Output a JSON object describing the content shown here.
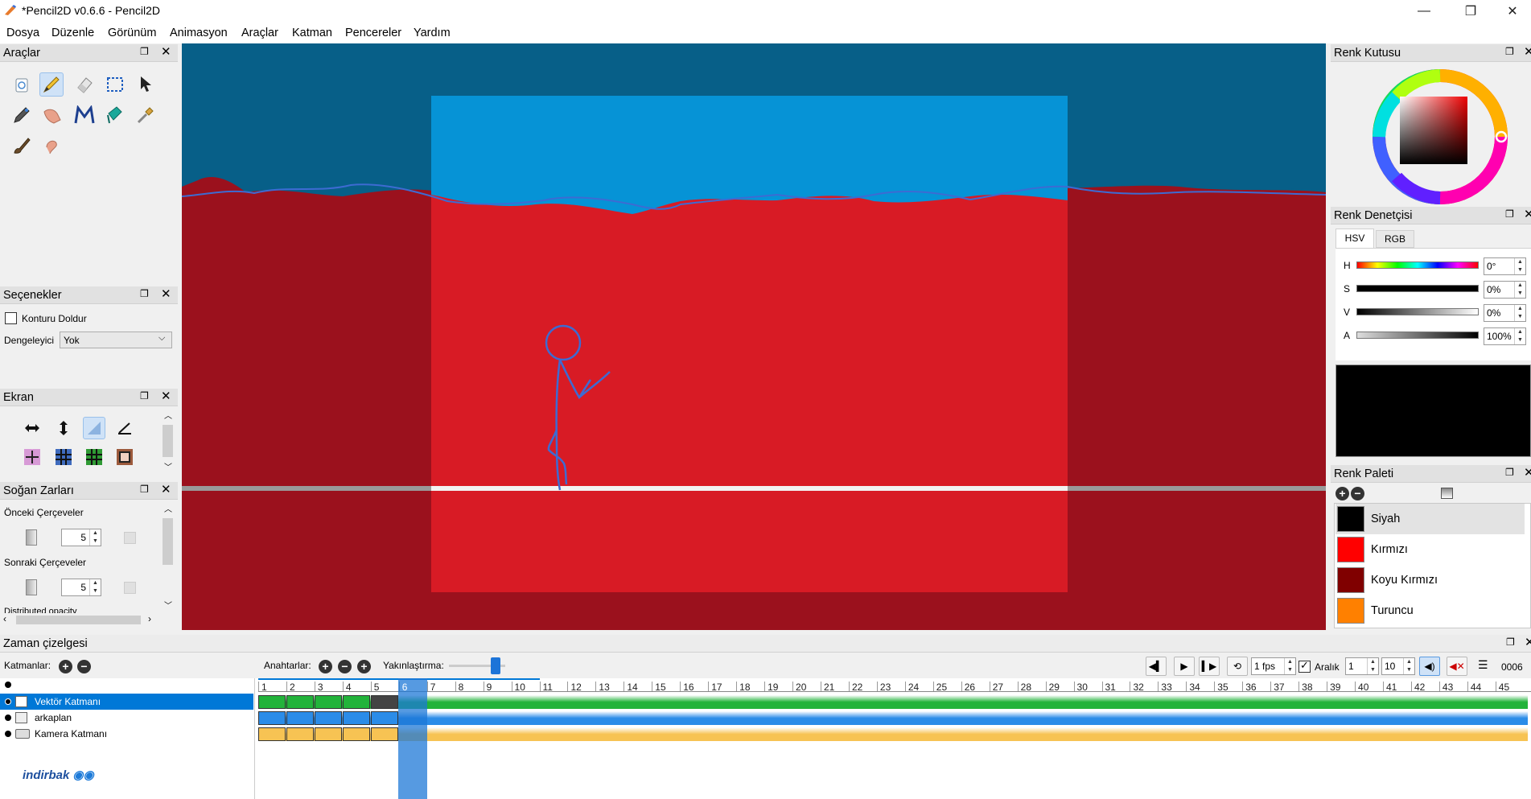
{
  "window": {
    "title": "*Pencil2D v0.6.6 - Pencil2D",
    "minimize": "—",
    "maximize": "❐",
    "close": "✕"
  },
  "menu": [
    "Dosya",
    "Düzenle",
    "Görünüm",
    "Animasyon",
    "Araçlar",
    "Katman",
    "Pencereler",
    "Yardım"
  ],
  "tools_panel": {
    "title": "Araçlar"
  },
  "options_panel": {
    "title": "Seçenekler",
    "fill_contour": "Konturu Doldur",
    "stabilizer_label": "Dengeleyici",
    "stabilizer_value": "Yok"
  },
  "display_panel": {
    "title": "Ekran"
  },
  "onion_panel": {
    "title": "Soğan Zarları",
    "prev_frames": "Önceki Çerçeveler",
    "prev_value": "5",
    "next_frames": "Sonraki Çerçeveler",
    "next_value": "5",
    "distributed": "Distributed opacity"
  },
  "color_box": {
    "title": "Renk Kutusu"
  },
  "color_inspector": {
    "title": "Renk Denetçisi",
    "tabs": [
      "HSV",
      "RGB"
    ],
    "rows": [
      {
        "label": "H",
        "value": "0°"
      },
      {
        "label": "S",
        "value": "0%"
      },
      {
        "label": "V",
        "value": "0%"
      },
      {
        "label": "A",
        "value": "100%"
      }
    ],
    "current_color": "#000000"
  },
  "palette": {
    "title": "Renk Paleti",
    "items": [
      {
        "name": "Siyah",
        "color": "#000000"
      },
      {
        "name": "Kırmızı",
        "color": "#ff0000"
      },
      {
        "name": "Koyu Kırmızı",
        "color": "#800000"
      },
      {
        "name": "Turuncu",
        "color": "#ff8000"
      }
    ]
  },
  "timeline": {
    "title": "Zaman çizelgesi",
    "layers_label": "Katmanlar:",
    "keys_label": "Anahtarlar:",
    "zoom_label": "Yakınlaştırma:",
    "fps_value": "1 fps",
    "range_label": "Aralık",
    "range_start": "1",
    "range_end": "10",
    "current_frame": "0006",
    "current_frame_index": 6,
    "layers": [
      {
        "name": "Vektör Katmanı",
        "color": "#22b33a",
        "selected": true
      },
      {
        "name": "arkaplan",
        "color": "#2b8ce8",
        "selected": false
      },
      {
        "name": "Kamera Katmanı",
        "color": "#f7c353",
        "selected": false
      }
    ],
    "frames": [
      "1",
      "2",
      "3",
      "4",
      "5",
      "6",
      "7",
      "8",
      "9",
      "10",
      "11",
      "12",
      "13",
      "14",
      "15",
      "16",
      "17",
      "18",
      "19",
      "20",
      "21",
      "22",
      "23",
      "24",
      "25",
      "26",
      "27",
      "28",
      "29",
      "30",
      "31",
      "32",
      "33",
      "34",
      "35",
      "36",
      "37",
      "38",
      "39",
      "40",
      "41",
      "42",
      "43",
      "44",
      "45"
    ]
  },
  "watermark": "indirbak"
}
